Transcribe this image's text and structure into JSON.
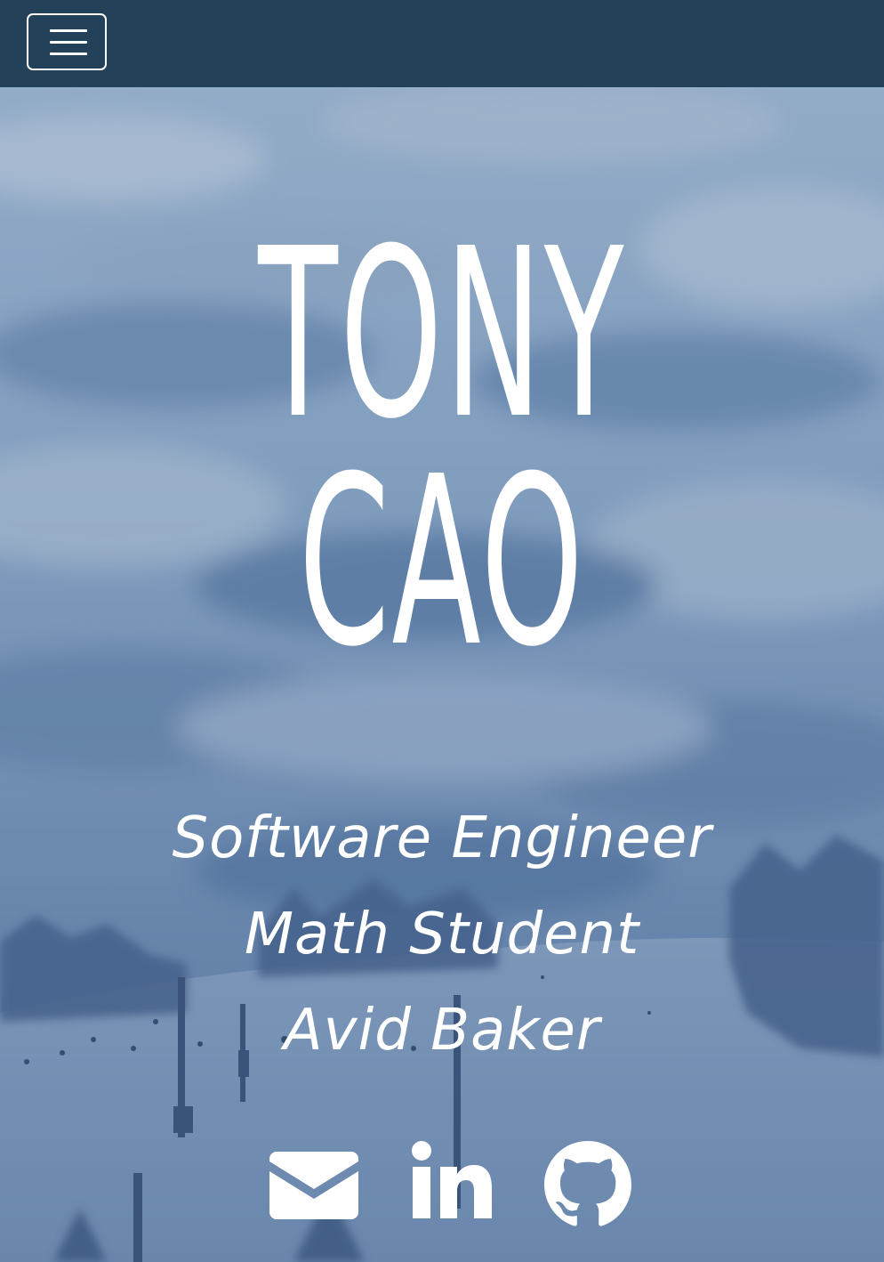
{
  "navbar": {
    "toggle_icon": "hamburger-menu-icon",
    "background_color": "#234159"
  },
  "hero": {
    "name_line1": "TONY",
    "name_line2": "CAO",
    "roles": [
      "Software Engineer",
      "Math Student",
      "Avid Baker"
    ],
    "background": "snowy-ski-hill-photo"
  },
  "socials": [
    {
      "icon": "envelope-icon"
    },
    {
      "icon": "linkedin-icon"
    },
    {
      "icon": "github-icon"
    }
  ]
}
